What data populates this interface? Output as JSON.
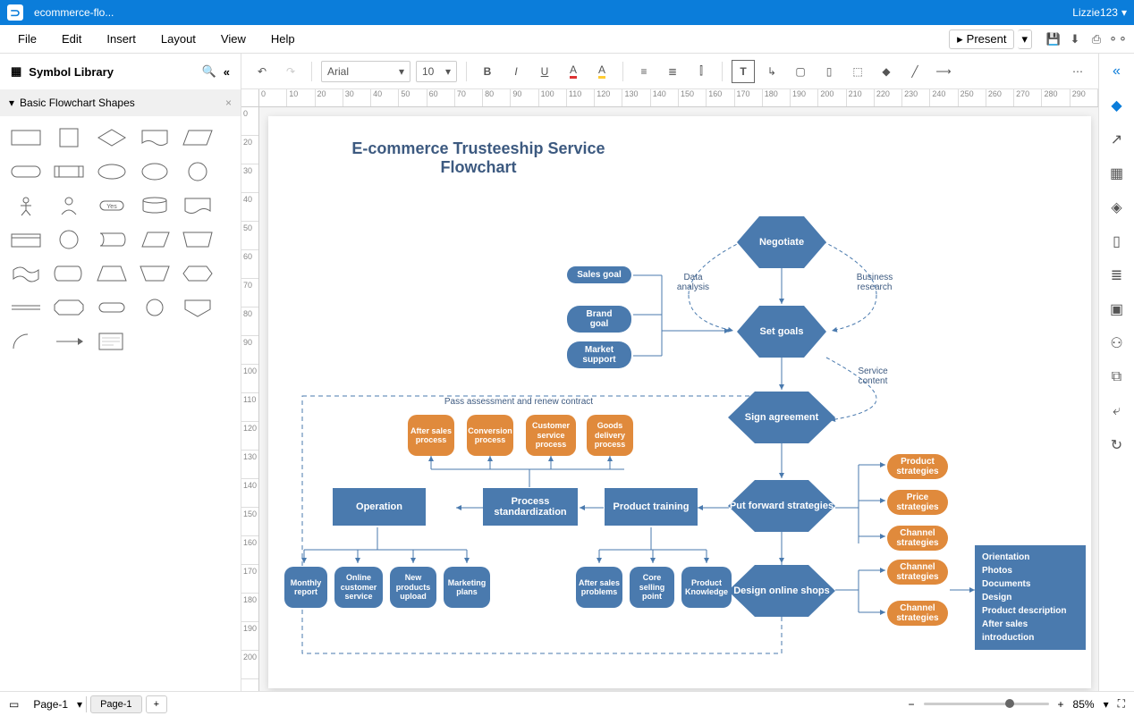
{
  "titlebar": {
    "doc_name": "ecommerce-flo...",
    "user": "Lizzie123"
  },
  "menu": {
    "file": "File",
    "edit": "Edit",
    "insert": "Insert",
    "layout": "Layout",
    "view": "View",
    "help": "Help",
    "present": "Present"
  },
  "lib_header": "Symbol Library",
  "section": "Basic Flowchart Shapes",
  "shape_yes": "Yes",
  "toolbar": {
    "font": "Arial",
    "size": "10"
  },
  "tabs": {
    "dropdown": "Page-1",
    "active": "Page-1"
  },
  "zoom": "85%",
  "chart": {
    "title": "E-commerce Trusteeship Service Flowchart",
    "negotiate": "Negotiate",
    "setgoals": "Set goals",
    "sign": "Sign agreement",
    "putforward": "Put forward strategies",
    "design": "Design online shops",
    "salesgoal": "Sales goal",
    "brandgoal": "Brand goal",
    "marketsupport": "Market support",
    "dataanalysis": "Data analysis",
    "businessresearch": "Business research",
    "servicecontent": "Service content",
    "pass": "Pass assessment and renew contract",
    "aftersales": "After sales process",
    "conversion": "Conversion process",
    "customer": "Customer service process",
    "goods": "Goods delivery process",
    "operation": "Operation",
    "processstd": "Process standardization",
    "training": "Product training",
    "monthly": "Monthly report",
    "onlinecs": "Online customer service",
    "newprod": "New products upload",
    "marketing": "Marketing plans",
    "aftersales2": "After sales problems",
    "core": "Core selling point",
    "prodknow": "Product Knowledge",
    "prodstrat": "Product strategies",
    "pricestrat": "Price strategies",
    "channelstrat": "Channel strategies",
    "channelstrat2": "Channel strategies",
    "channelstrat3": "Channel strategies",
    "list": {
      "orientation": "Orientation",
      "photos": "Photos",
      "documents": "Documents",
      "design": "Design",
      "proddesc": "Product description",
      "aftersales": "After sales",
      "intro": "introduction"
    }
  }
}
